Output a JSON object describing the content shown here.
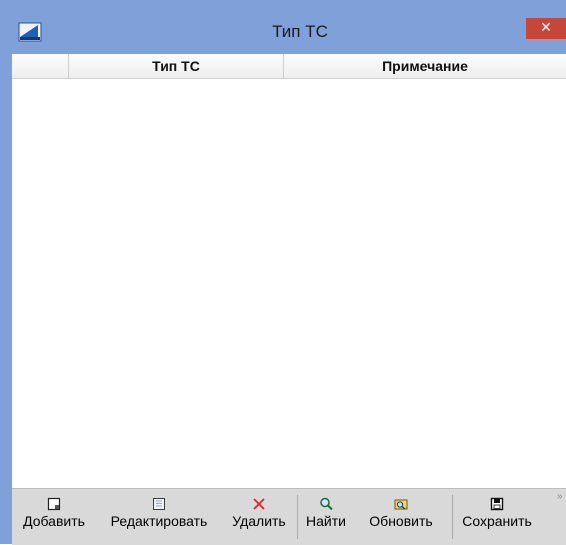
{
  "window": {
    "title": "Тип ТС",
    "close_glyph": "✕"
  },
  "grid": {
    "columns": [
      "",
      "Тип ТС",
      "Примечание"
    ],
    "rows": []
  },
  "toolbar": {
    "buttons": [
      {
        "label": "Добавить",
        "icon": "new-document-icon"
      },
      {
        "label": "Редактировать",
        "icon": "edit-document-icon"
      },
      {
        "label": "Удалить",
        "icon": "delete-x-icon"
      },
      {
        "label": "Найти",
        "icon": "search-icon"
      },
      {
        "label": "Обновить",
        "icon": "refresh-icon"
      },
      {
        "label": "Сохранить",
        "icon": "save-icon"
      }
    ],
    "overflow_glyph": "»"
  },
  "colors": {
    "frame": "#7fa0d8",
    "close": "#c7463a",
    "toolbar": "#d9d9d9",
    "delete": "#e02424"
  }
}
